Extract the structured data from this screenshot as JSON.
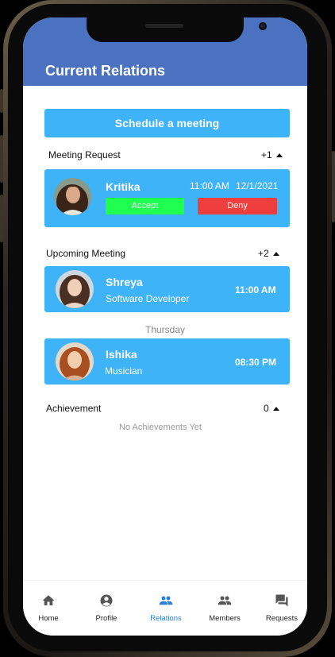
{
  "header": {
    "title": "Current Relations"
  },
  "schedule_button": {
    "label": "Schedule a meeting"
  },
  "meeting_request": {
    "title": "Meeting Request",
    "count": "+1",
    "card": {
      "name": "Kritika",
      "time": "11:00 AM",
      "date": "12/1/2021",
      "accept_label": "Accept",
      "deny_label": "Deny"
    }
  },
  "upcoming_meeting": {
    "title": "Upcoming Meeting",
    "count": "+2",
    "items": [
      {
        "name": "Shreya",
        "role": "Software Developer",
        "time": "11:00 AM"
      },
      {
        "name": "Ishika",
        "role": "Musician",
        "time": "08:30 PM"
      }
    ],
    "day_separator": "Thursday"
  },
  "achievement": {
    "title": "Achievement",
    "count": "0",
    "empty_text": "No Achievements Yet"
  },
  "bottom_nav": {
    "items": [
      {
        "label": "Home",
        "icon": "home-icon"
      },
      {
        "label": "Profile",
        "icon": "account-circle-icon"
      },
      {
        "label": "Relations",
        "icon": "people-icon",
        "active": true
      },
      {
        "label": "Members",
        "icon": "people-icon"
      },
      {
        "label": "Requests",
        "icon": "chat-icon"
      }
    ]
  },
  "colors": {
    "header_bg": "#4a72c0",
    "card_bg": "#3fb3f8",
    "accept_bg": "#1fff4f",
    "deny_bg": "#ef3e3e",
    "active_nav": "#2a7fd6"
  }
}
